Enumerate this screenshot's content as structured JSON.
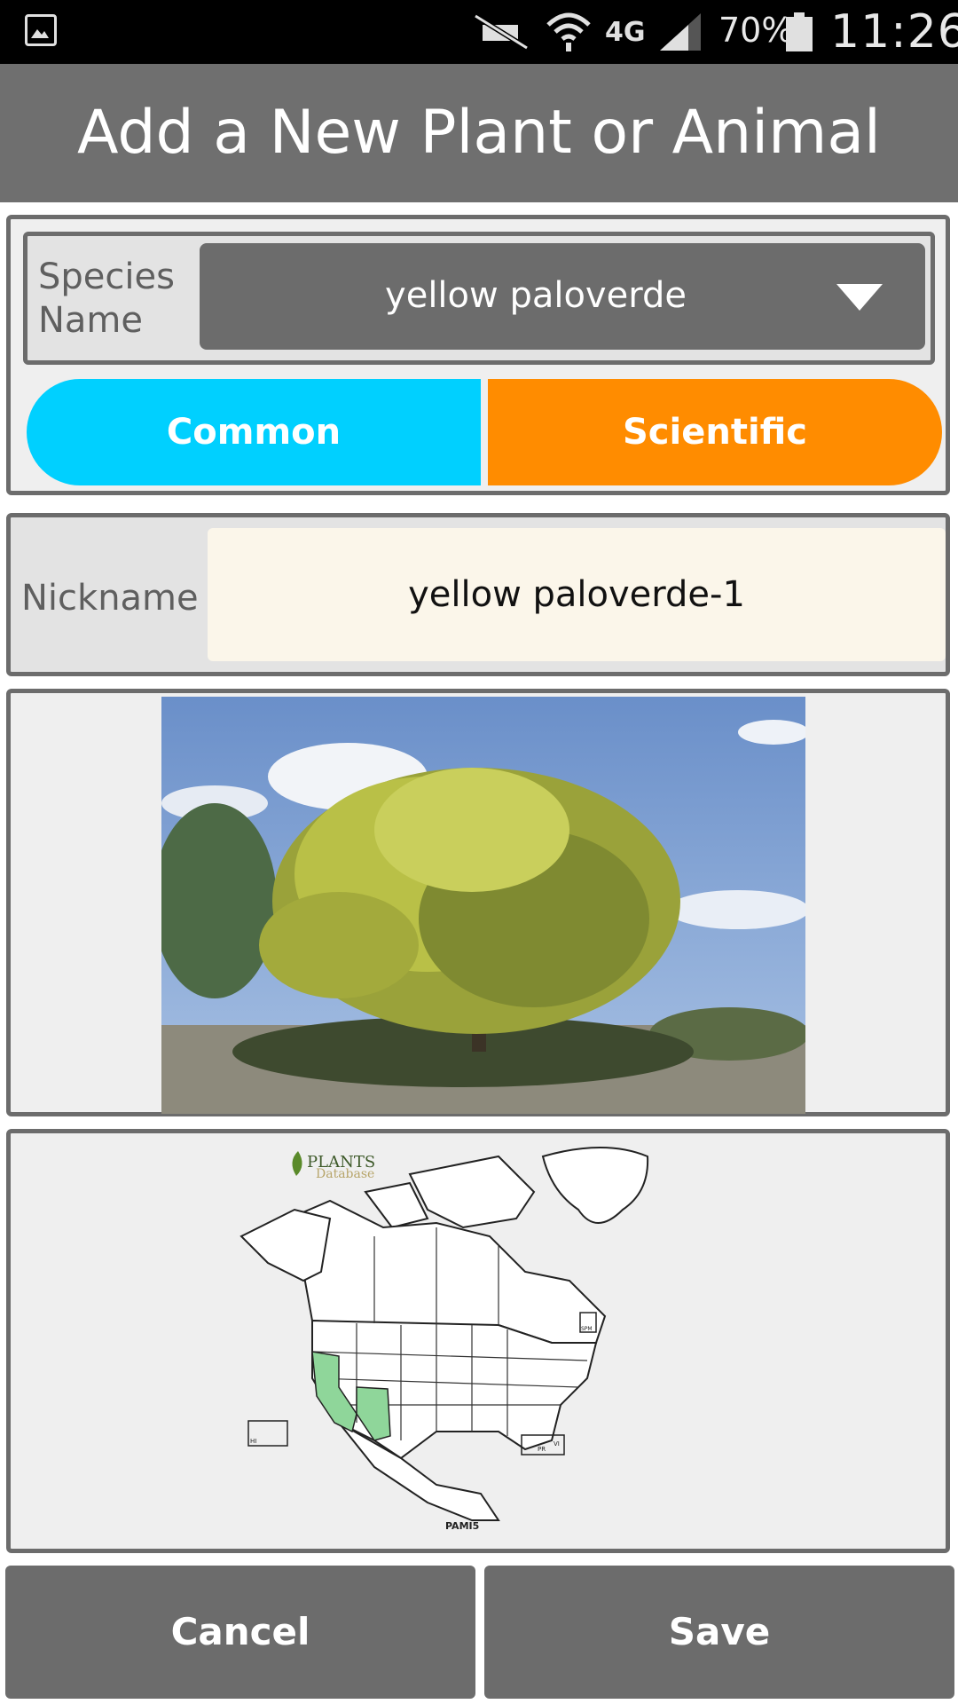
{
  "status_bar": {
    "battery": "70%",
    "time": "11:26",
    "network": "4G",
    "icons": [
      "image-icon",
      "mute-icon",
      "wifi-icon",
      "network-4g-icon",
      "signal-icon",
      "battery-icon"
    ]
  },
  "header": {
    "title": "Add a New Plant or Animal"
  },
  "species": {
    "label": "Species Name",
    "selected": "yellow paloverde",
    "toggle_common": "Common",
    "toggle_scientific": "Scientific"
  },
  "nickname": {
    "label": "Nickname",
    "value": "yellow paloverde-1"
  },
  "map": {
    "logo_top": "PLANTS",
    "logo_bottom": "Database",
    "code": "PAMI5",
    "labels": [
      "HI",
      "PR",
      "VI",
      "SPM"
    ]
  },
  "actions": {
    "cancel": "Cancel",
    "save": "Save"
  },
  "colors": {
    "common": "#00D0FF",
    "scientific": "#FF8C00",
    "header": "#6F6F6F",
    "map_highlight": "#8FD69A"
  }
}
